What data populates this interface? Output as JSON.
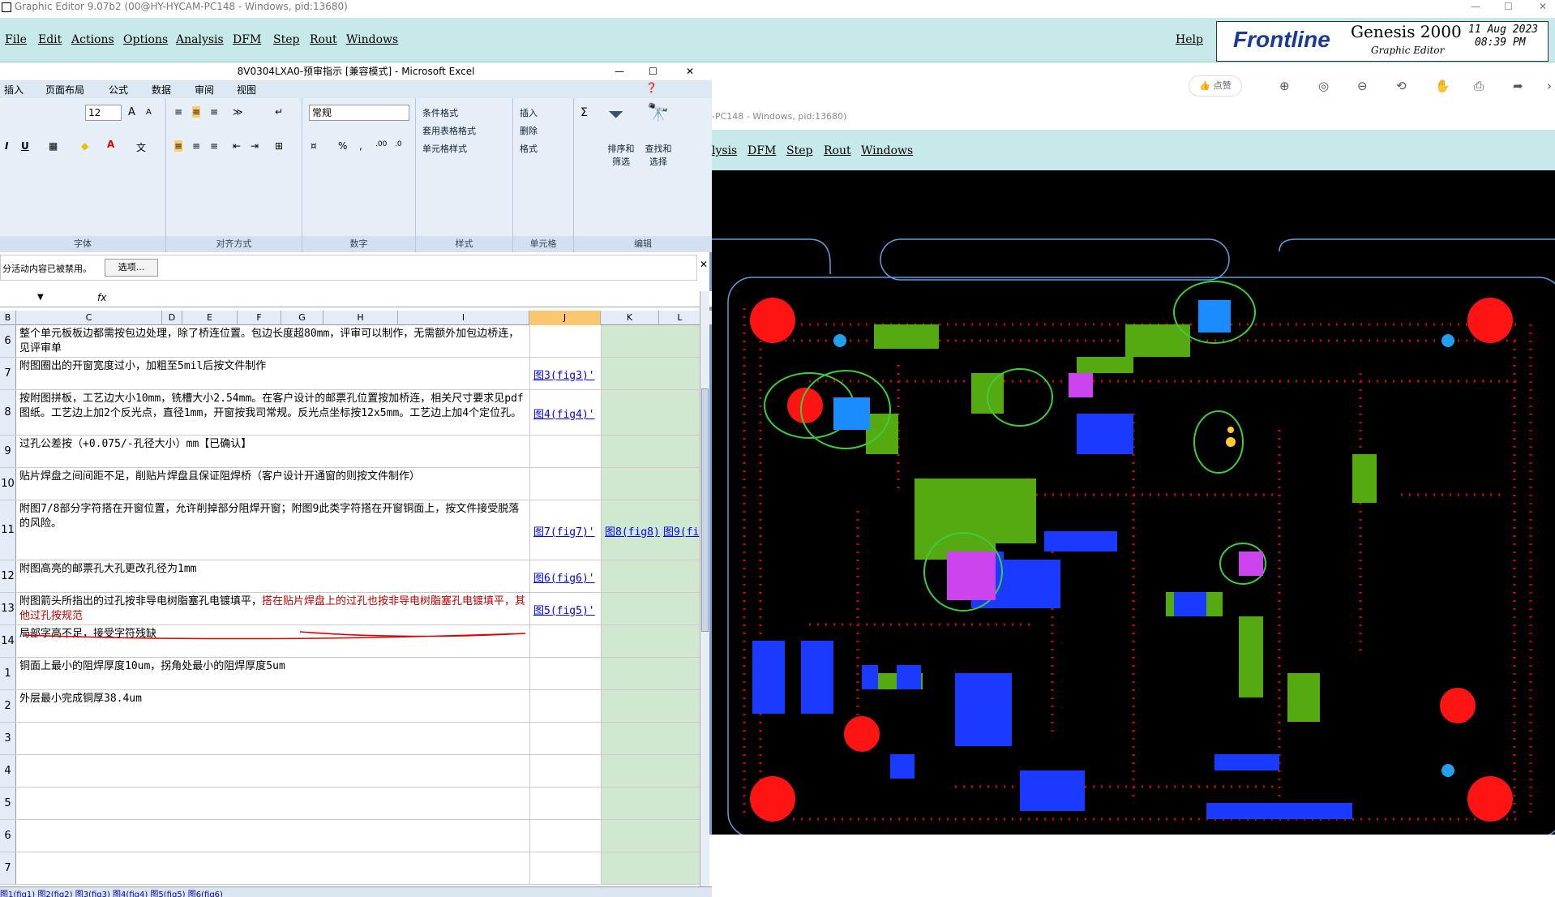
{
  "genesis": {
    "title": "Graphic Editor 9.07b2 (00@HY-HYCAM-PC148 - Windows, pid:13680)",
    "menu": [
      "File",
      "Edit",
      "Actions",
      "Options",
      "Analysis",
      "DFM",
      "Step",
      "Rout",
      "Windows"
    ],
    "help": "Help",
    "logo_brand": "Frontline",
    "logo_product": "Genesis 2000",
    "logo_sub": "Graphic Editor",
    "date": "11 Aug 2023",
    "time": "08:39 PM"
  },
  "viewer": {
    "like_label": "点赞",
    "title": "-PC148 - Windows, pid:13680)",
    "menu": [
      "lysis",
      "DFM",
      "Step",
      "Rout",
      "Windows"
    ]
  },
  "excel": {
    "title": "8V0304LXA0-预审指示 [兼容模式] - Microsoft Excel",
    "tabs": [
      "插入",
      "页面布局",
      "公式",
      "数据",
      "审阅",
      "视图"
    ],
    "font_size": "12",
    "number_format": "常规",
    "groups": [
      "字体",
      "对齐方式",
      "数字",
      "样式",
      "单元格",
      "编辑"
    ],
    "styles": [
      "条件格式",
      "套用表格格式",
      "单元格样式"
    ],
    "cells": [
      "插入",
      "删除",
      "格式"
    ],
    "edit": [
      "排序和筛选",
      "查找和选择"
    ],
    "message": "分活动内容已被禁用。",
    "options_btn": "选项...",
    "fx": "fx",
    "columns": [
      "B",
      "C",
      "D",
      "E",
      "F",
      "G",
      "H",
      "I",
      "J",
      "K",
      "L"
    ],
    "rows": [
      {
        "n": "6",
        "text": "整个单元板板边都需按包边处理，除了桥连位置。包边长度超80mm，评审可以制作，无需额外加包边桥连，见评审单",
        "red": "",
        "links": []
      },
      {
        "n": "7",
        "text": "附图圈出的开窗宽度过小，加粗至5mil后按文件制作",
        "red": "",
        "links": [
          "图3(fig3)'"
        ]
      },
      {
        "n": "8",
        "text": "按附图拼板，工艺边大小10mm，铣槽大小2.54mm。在客户设计的邮票孔位置按加桥连，相关尺寸要求见pdf图纸。工艺边上加2个反光点，直径1mm，开窗按我司常规。反光点坐标按12x5mm。工艺边上加4个定位孔。",
        "red": "",
        "links": [
          "图4(fig4)'"
        ]
      },
      {
        "n": "9",
        "text": "过孔公差按（+0.075/-孔径大小）mm【已确认】",
        "red": "",
        "links": []
      },
      {
        "n": "10",
        "text": "贴片焊盘之间间距不足，削贴片焊盘且保证阻焊桥（客户设计开通窗的则按文件制作）",
        "red": "",
        "links": []
      },
      {
        "n": "11",
        "text": "附图7/8部分字符搭在开窗位置，允许削掉部分阻焊开窗；附图9此类字符搭在开窗铜面上，按文件接受脱落的风险。",
        "red": "",
        "links": [
          "图7(fig7)'",
          "图8(fig8)",
          "图9(fi"
        ]
      },
      {
        "n": "12",
        "text": "附图高亮的邮票孔大孔更改孔径为1mm",
        "red": "",
        "links": [
          "图6(fig6)'"
        ]
      },
      {
        "n": "13",
        "text": "附图箭头所指出的过孔按非导电树脂塞孔电镀填平，",
        "red": "搭在贴片焊盘上的过孔也按非导电树脂塞孔电镀填平，其他过孔按规范",
        "links": [
          "图5(fig5)'"
        ]
      },
      {
        "n": "14",
        "text": "局部字高不足，接受字符残缺",
        "red": "",
        "links": []
      },
      {
        "n": "1",
        "text": "铜面上最小的阻焊厚度10um，拐角处最小的阻焊厚度5um",
        "red": "",
        "links": []
      },
      {
        "n": "2",
        "text": "外层最小完成铜厚38.4um",
        "red": "",
        "links": []
      },
      {
        "n": "3",
        "text": "",
        "red": "",
        "links": []
      },
      {
        "n": "4",
        "text": "",
        "red": "",
        "links": []
      },
      {
        "n": "5",
        "text": "",
        "red": "",
        "links": []
      },
      {
        "n": "6",
        "text": "",
        "red": "",
        "links": []
      },
      {
        "n": "7",
        "text": "",
        "red": "",
        "links": []
      }
    ],
    "sheet_tabs": "图1(fig1) 图2(fig2) 图3(fig3) 图4(fig4) 图5(fig5) 图6(fig6)"
  },
  "colors": {
    "pcb_bg": "#000000",
    "pad_red": "#ff0000",
    "pad_blue": "#0033ff",
    "pad_green": "#55aa11",
    "outline": "#5aa0e0",
    "menubar": "#c8e9e9"
  }
}
